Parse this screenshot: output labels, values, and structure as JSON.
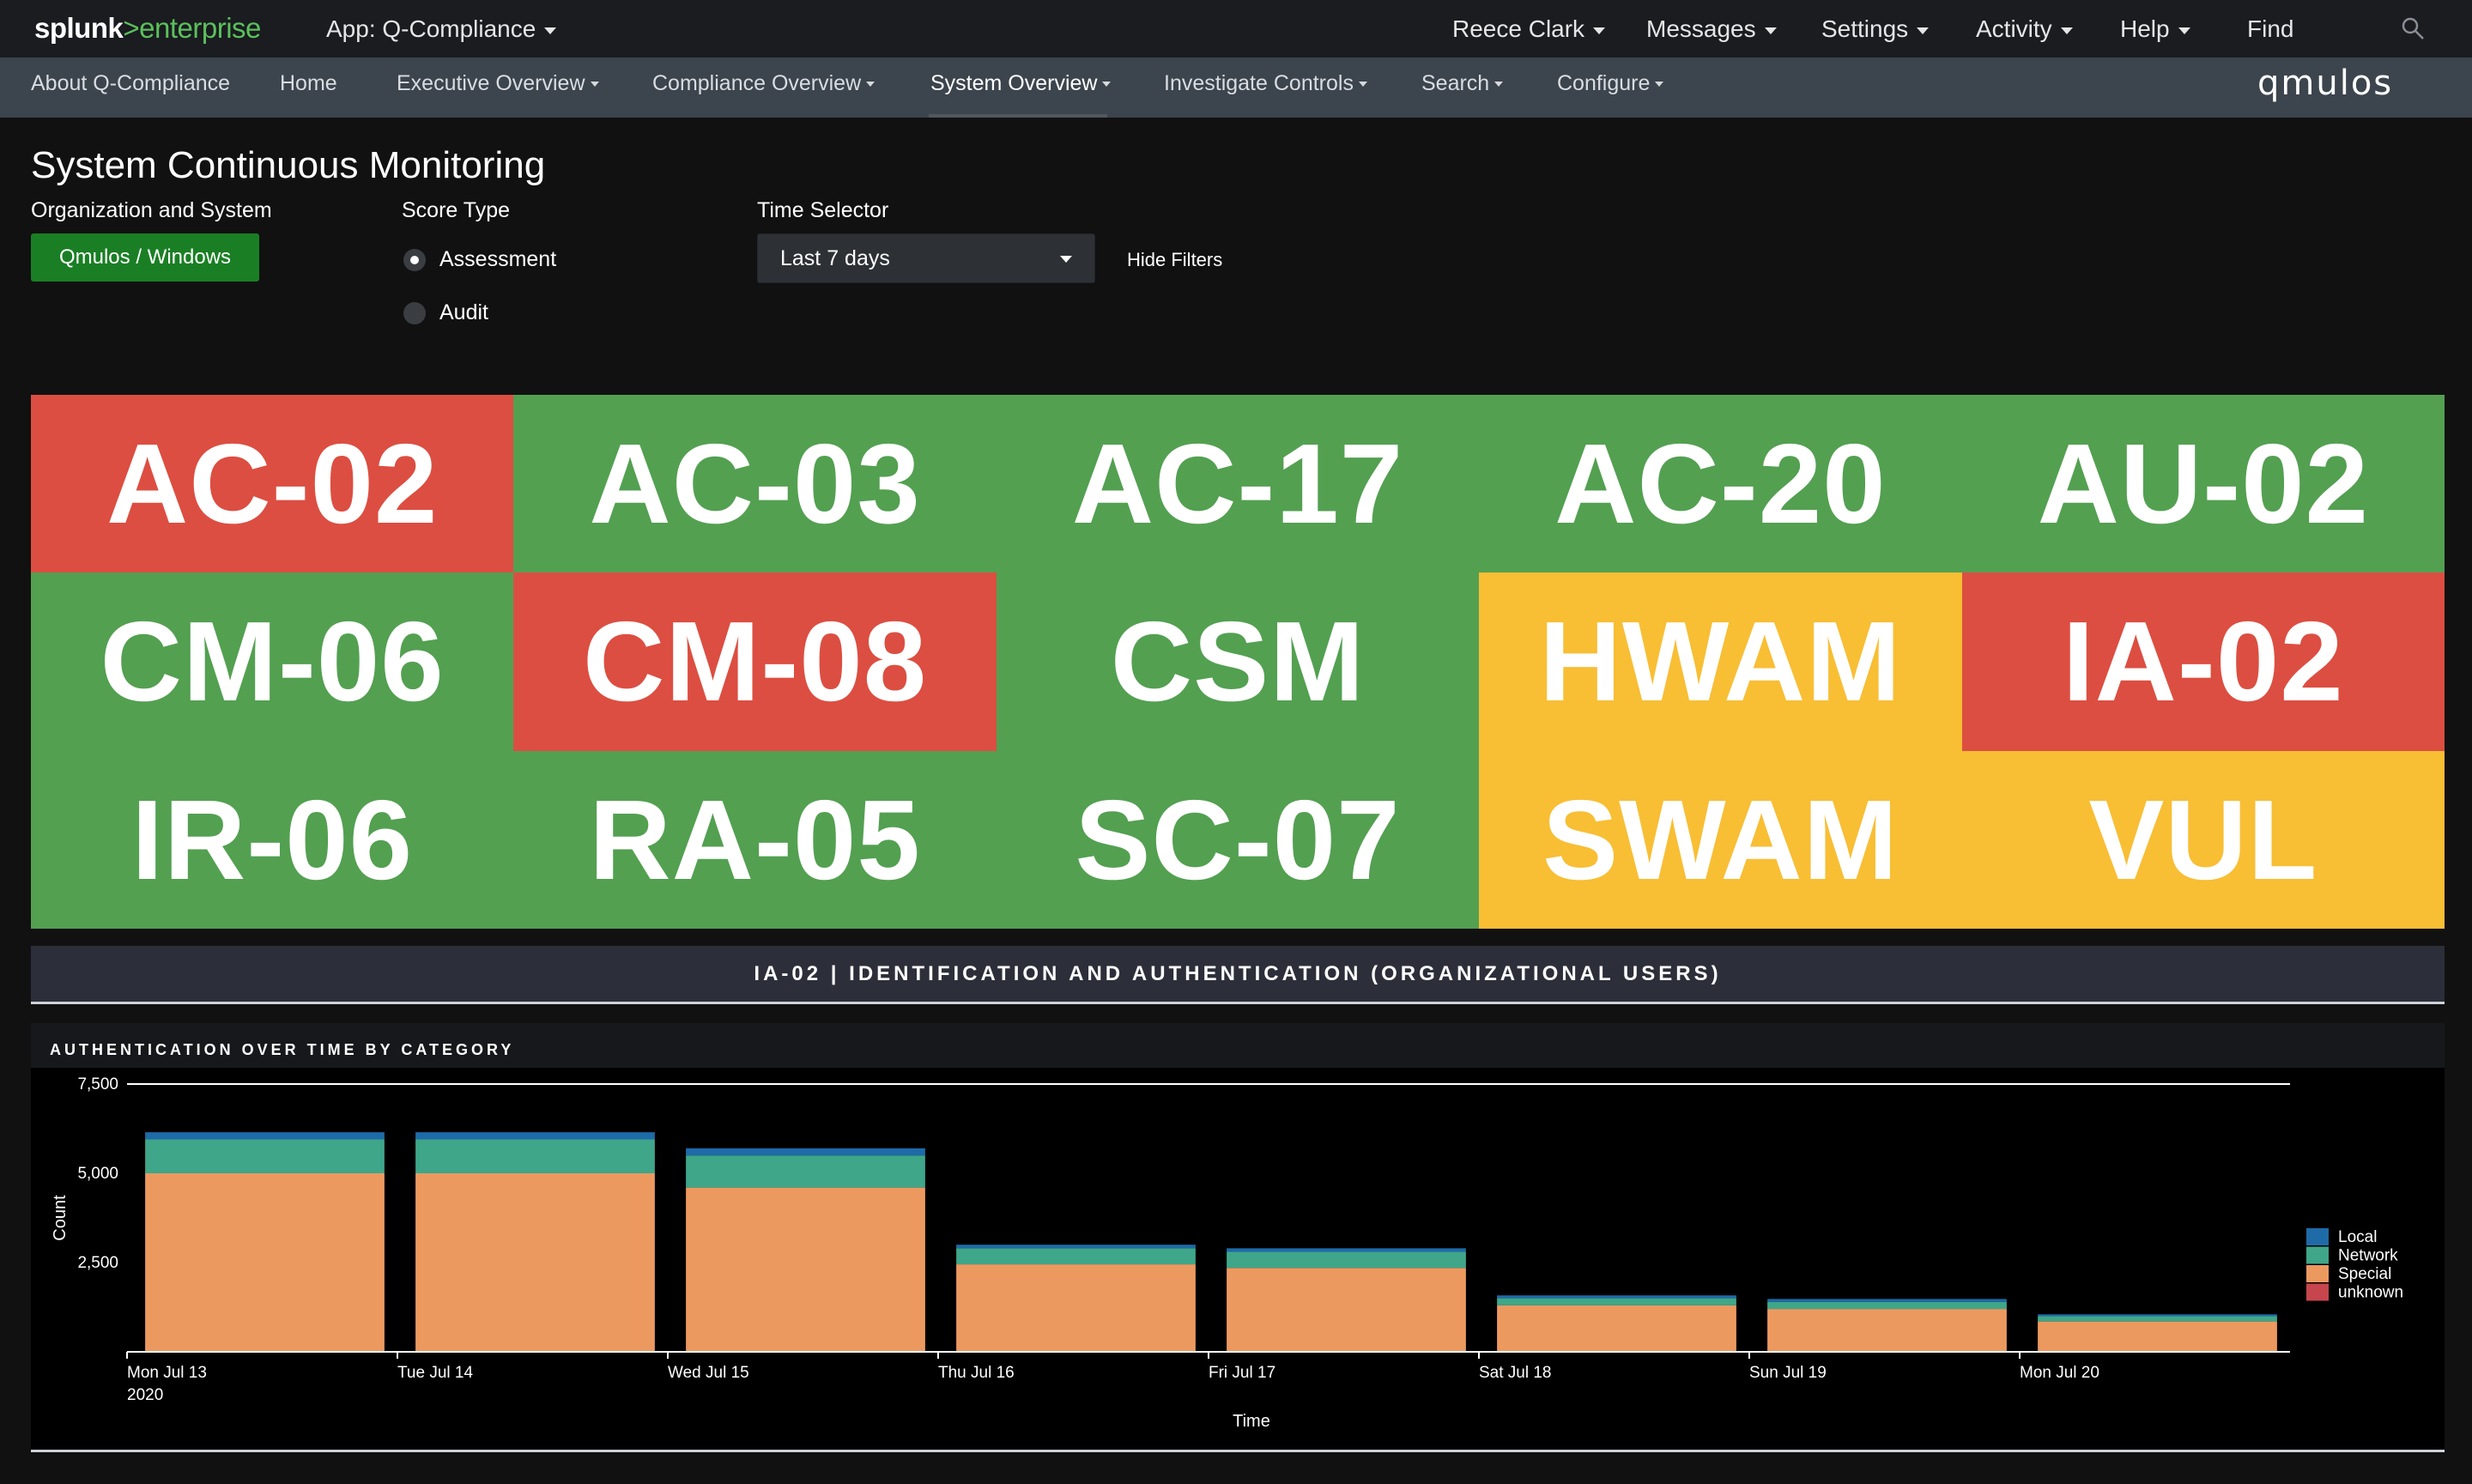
{
  "topbar": {
    "logo_splunk": "splunk",
    "logo_gt": ">",
    "logo_enterprise": "enterprise",
    "app_menu": "App: Q-Compliance",
    "user": "Reece Clark",
    "messages": "Messages",
    "settings": "Settings",
    "activity": "Activity",
    "help": "Help",
    "find": "Find"
  },
  "appnav": {
    "items": [
      "About Q-Compliance",
      "Home",
      "Executive Overview",
      "Compliance Overview",
      "System Overview",
      "Investigate Controls",
      "Search",
      "Configure"
    ],
    "active": "System Overview",
    "brand": "qmulos"
  },
  "page": {
    "title": "System Continuous Monitoring"
  },
  "filters": {
    "org_label": "Organization and System",
    "org_value": "Qmulos / Windows",
    "score_label": "Score Type",
    "score_options": [
      "Assessment",
      "Audit"
    ],
    "score_selected": "Assessment",
    "time_label": "Time Selector",
    "time_value": "Last 7 days",
    "hide_filters": "Hide Filters"
  },
  "colors": {
    "red": "#dc4e41",
    "green": "#53a051",
    "yellow": "#f8be34",
    "local": "#1e6ba8",
    "network": "#3fa68a",
    "special": "#ec9960",
    "unknown": "#c7454d"
  },
  "tiles": [
    {
      "label": "AC-02",
      "status": "red"
    },
    {
      "label": "AC-03",
      "status": "green"
    },
    {
      "label": "AC-17",
      "status": "green"
    },
    {
      "label": "AC-20",
      "status": "green"
    },
    {
      "label": "AU-02",
      "status": "green"
    },
    {
      "label": "CM-06",
      "status": "green"
    },
    {
      "label": "CM-08",
      "status": "red"
    },
    {
      "label": "CSM",
      "status": "green"
    },
    {
      "label": "HWAM",
      "status": "yellow"
    },
    {
      "label": "IA-02",
      "status": "red"
    },
    {
      "label": "IR-06",
      "status": "green"
    },
    {
      "label": "RA-05",
      "status": "green"
    },
    {
      "label": "SC-07",
      "status": "green"
    },
    {
      "label": "SWAM",
      "status": "yellow"
    },
    {
      "label": "VUL",
      "status": "yellow"
    }
  ],
  "control_banner": "IA-02 | IDENTIFICATION AND AUTHENTICATION (ORGANIZATIONAL USERS)",
  "panel": {
    "title": "AUTHENTICATION OVER TIME BY CATEGORY"
  },
  "chart_data": {
    "type": "bar",
    "stacked": true,
    "categories": [
      "Mon Jul 13",
      "Tue Jul 14",
      "Wed Jul 15",
      "Thu Jul 16",
      "Fri Jul 17",
      "Sat Jul 18",
      "Sun Jul 19",
      "Mon Jul 20"
    ],
    "first_tick_year": "2020",
    "series": [
      {
        "name": "Special",
        "values": [
          5000,
          5000,
          4600,
          2450,
          2350,
          1300,
          1200,
          850
        ]
      },
      {
        "name": "Network",
        "values": [
          950,
          950,
          900,
          450,
          450,
          200,
          200,
          150
        ]
      },
      {
        "name": "Local",
        "values": [
          200,
          200,
          200,
          100,
          100,
          80,
          80,
          50
        ]
      },
      {
        "name": "unknown",
        "values": [
          0,
          0,
          0,
          0,
          0,
          0,
          0,
          0
        ]
      }
    ],
    "legend_order": [
      "Local",
      "Network",
      "Special",
      "unknown"
    ],
    "legend_position": "right",
    "xlabel": "Time",
    "ylabel": "Count",
    "ylim": [
      0,
      7500
    ],
    "yticks": [
      2500,
      5000,
      7500
    ],
    "ytick_labels": [
      "2,500",
      "5,000",
      "7,500"
    ]
  }
}
